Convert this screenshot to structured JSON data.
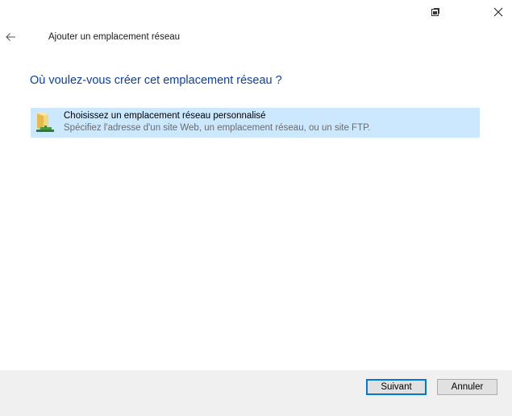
{
  "titlebar": {
    "restore_icon": "window-restore-icon",
    "close_icon": "close-icon"
  },
  "nav": {
    "back_icon": "back-arrow-icon",
    "wizard_title": "Ajouter un emplacement réseau"
  },
  "main": {
    "heading": "Où voulez-vous créer cet emplacement réseau ?",
    "options": [
      {
        "icon": "network-folder-icon",
        "title": "Choisissez un emplacement réseau personnalisé",
        "description": "Spécifiez l'adresse d'un site Web, un emplacement réseau, ou un site FTP.",
        "selected": true
      }
    ]
  },
  "footer": {
    "next_label": "Suivant",
    "cancel_label": "Annuler"
  },
  "colors": {
    "heading": "#0b3fa8",
    "selection": "#cce8ff",
    "footer_bg": "#f0f0f0",
    "default_button_border": "#0078d7"
  }
}
